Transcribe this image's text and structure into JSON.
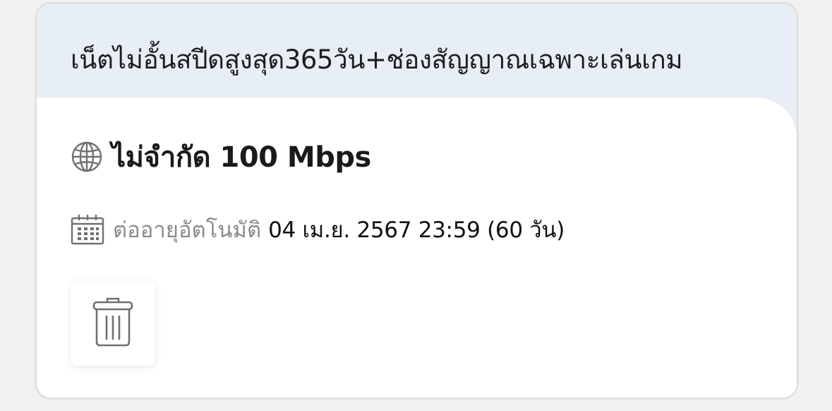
{
  "package": {
    "title": "เน็ตไม่อั้นสปีดสูงสุด365วัน+ช่องสัญญาณเฉพาะเล่นเกม",
    "speed_text": "ไม่จำกัด 100 Mbps",
    "renew_label": "ต่ออายุอัตโนมัติ",
    "renew_date": "04 เม.ย. 2567 23:59 (60 วัน)"
  },
  "icons": {
    "speed": "globe-icon",
    "renew": "calendar-icon",
    "delete": "trash-icon"
  },
  "colors": {
    "header_bg": "#e7eef5",
    "icon_gray": "#707070"
  }
}
